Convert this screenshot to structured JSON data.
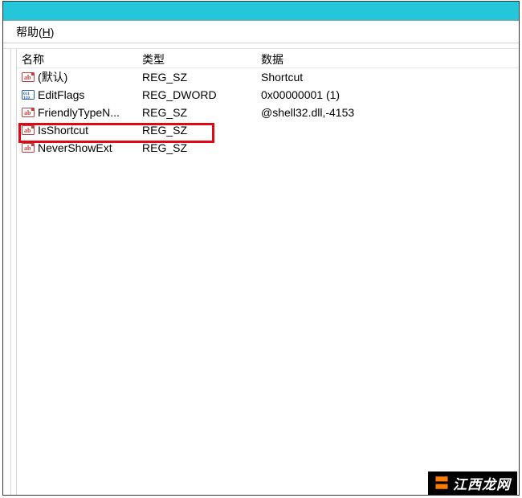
{
  "menu": {
    "help": "帮助(H)"
  },
  "columns": {
    "name": "名称",
    "type": "类型",
    "data": "数据"
  },
  "rows": [
    {
      "icon": "sz",
      "name": "(默认)",
      "type": "REG_SZ",
      "data": "Shortcut"
    },
    {
      "icon": "dw",
      "name": "EditFlags",
      "type": "REG_DWORD",
      "data": "0x00000001 (1)"
    },
    {
      "icon": "sz",
      "name": "FriendlyTypeN...",
      "type": "REG_SZ",
      "data": "@shell32.dll,-4153"
    },
    {
      "icon": "sz",
      "name": "IsShortcut",
      "type": "REG_SZ",
      "data": ""
    },
    {
      "icon": "sz",
      "name": "NeverShowExt",
      "type": "REG_SZ",
      "data": ""
    }
  ],
  "colors": {
    "titlebar": "#26c6da",
    "highlight": "#e30613"
  },
  "watermark": {
    "text": "江西龙网"
  }
}
